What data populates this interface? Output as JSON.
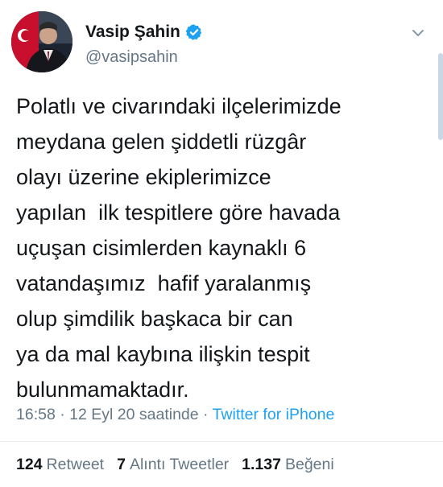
{
  "author": {
    "display_name": "Vasip Şahin",
    "handle": "@vasipsahin"
  },
  "icons": {
    "verified": "verified-badge-icon",
    "more": "chevron-down-icon"
  },
  "colors": {
    "link": "#1da1f2",
    "muted": "#657786",
    "text": "#14171a",
    "flag_red": "#e30a17"
  },
  "tweet": {
    "text": "Polatlı ve civarındaki ilçelerimizde\nmeydana gelen şiddetli rüzgâr\nolayı üzerine ekiplerimizce\nyapılan  ilk tespitlere göre havada\nuçuşan cisimlerden kaynaklı 6\nvatandaşımız  hafif yaralanmış\nolup şimdilik başkaca bir can\nya da mal kaybına ilişkin tespit\nbulunmamaktadır.",
    "time": "16:58",
    "date": "12 Eyl 20 saatinde",
    "separator": " · ",
    "source": "Twitter for iPhone"
  },
  "stats": {
    "retweets_count": "124",
    "retweets_label": "Retweet",
    "quotes_count": "7",
    "quotes_label": "Alıntı Tweetler",
    "likes_count": "1.137",
    "likes_label": "Beğeni"
  }
}
